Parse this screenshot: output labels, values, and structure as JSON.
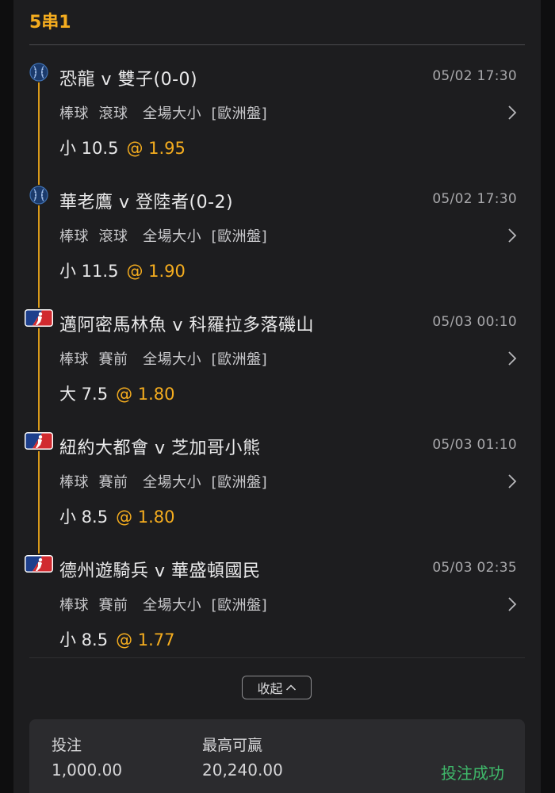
{
  "parlay": {
    "title": "5串1"
  },
  "legs": [
    {
      "icon": "baseball-ball-icon",
      "teams": "恐龍 v 雙子(0-0)",
      "time": "05/02 17:30",
      "market": "棒球  滾球   全場大小  [歐洲盤]",
      "selection": "小 10.5",
      "odds": "@ 1.95"
    },
    {
      "icon": "baseball-ball-icon",
      "teams": "華老鷹 v 登陸者(0-2)",
      "time": "05/02 17:30",
      "market": "棒球  滾球   全場大小  [歐洲盤]",
      "selection": "小 11.5",
      "odds": "@ 1.90"
    },
    {
      "icon": "mlb-logo-icon",
      "teams": "邁阿密馬林魚 v 科羅拉多落磯山",
      "time": "05/03 00:10",
      "market": "棒球  賽前   全場大小  [歐洲盤]",
      "selection": "大 7.5",
      "odds": "@ 1.80"
    },
    {
      "icon": "mlb-logo-icon",
      "teams": "紐約大都會 v 芝加哥小熊",
      "time": "05/03 01:10",
      "market": "棒球  賽前   全場大小  [歐洲盤]",
      "selection": "小 8.5",
      "odds": "@ 1.80"
    },
    {
      "icon": "mlb-logo-icon",
      "teams": "德州遊騎兵 v 華盛頓國民",
      "time": "05/03 02:35",
      "market": "棒球  賽前   全場大小  [歐洲盤]",
      "selection": "小 8.5",
      "odds": "@ 1.77"
    }
  ],
  "collapse": {
    "label": "收起"
  },
  "summary": {
    "stake_label": "投注",
    "stake_value": "1,000.00",
    "max_win_label": "最高可贏",
    "max_win_value": "20,240.00",
    "status": "投注成功"
  },
  "colors": {
    "accent": "#f5ad1f",
    "success": "#3fb86a",
    "card_bg": "#1d1d1f",
    "summary_bg": "#2b2b2e"
  }
}
